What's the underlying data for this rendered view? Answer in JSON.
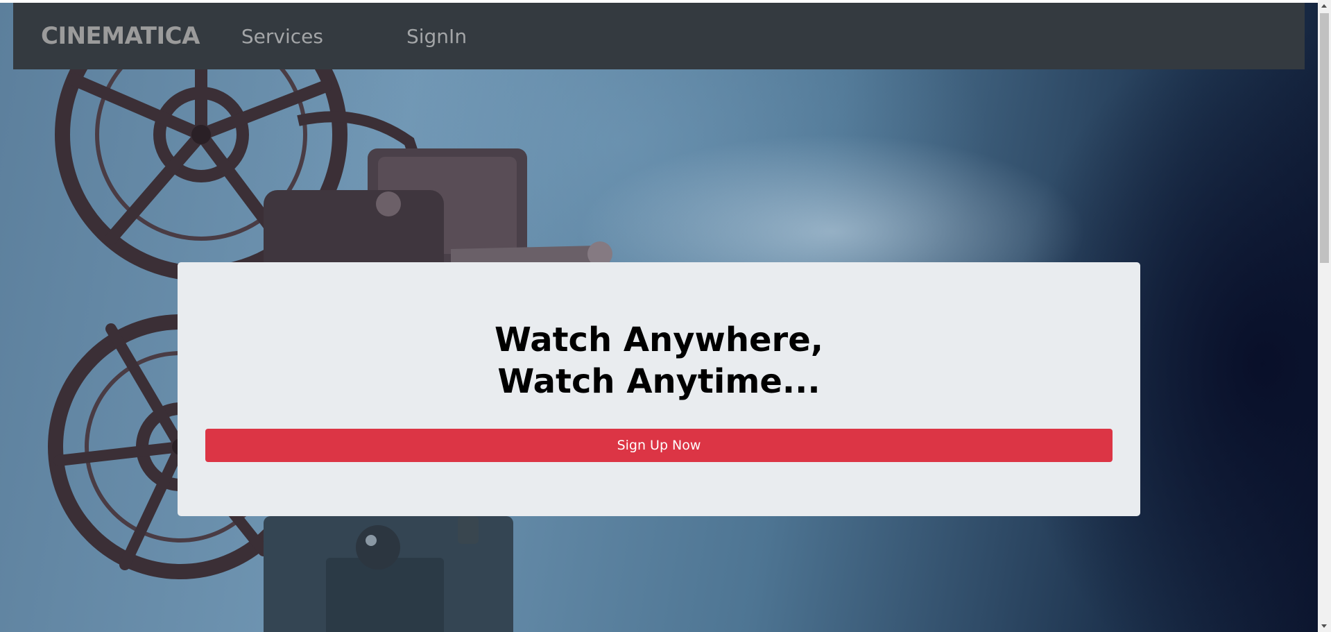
{
  "navbar": {
    "brand": "CINEMATICA",
    "links": [
      {
        "label": "Services"
      },
      {
        "label": "SignIn"
      }
    ]
  },
  "hero": {
    "headline_line1": "Watch Anywhere,",
    "headline_line2": "Watch Anytime...",
    "cta_label": "Sign Up Now"
  },
  "colors": {
    "navbar_bg": "#343a40",
    "card_bg": "#e9ecef",
    "cta_bg": "#dc3545"
  }
}
